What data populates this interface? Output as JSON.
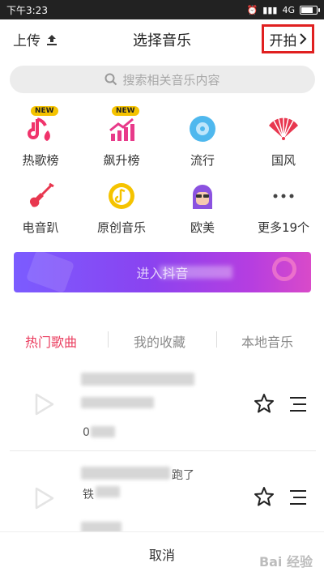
{
  "status_bar": {
    "time": "下午3:23",
    "network": "4G"
  },
  "nav": {
    "upload_label": "上传",
    "title": "选择音乐",
    "start_label": "开拍"
  },
  "search": {
    "placeholder": "搜索相关音乐内容"
  },
  "categories": [
    {
      "label": "热歌榜",
      "icon": "hot-songs-icon",
      "badge": "NEW"
    },
    {
      "label": "飙升榜",
      "icon": "rising-chart-icon",
      "badge": "NEW"
    },
    {
      "label": "流行",
      "icon": "pop-disc-icon"
    },
    {
      "label": "国风",
      "icon": "chinese-fan-icon"
    },
    {
      "label": "电音趴",
      "icon": "electric-guitar-icon"
    },
    {
      "label": "原创音乐",
      "icon": "original-music-icon"
    },
    {
      "label": "欧美",
      "icon": "western-singer-icon"
    },
    {
      "label": "更多19个",
      "icon": "more-dots-icon"
    }
  ],
  "banner": {
    "text": "进入抖音"
  },
  "tabs": [
    {
      "label": "热门歌曲",
      "active": true
    },
    {
      "label": "我的收藏",
      "active": false
    },
    {
      "label": "本地音乐",
      "active": false
    }
  ],
  "songs": [
    {
      "title": "",
      "artist": "",
      "duration": "0"
    },
    {
      "title": "跑了",
      "artist": "铁",
      "duration": ""
    }
  ],
  "footer": {
    "cancel_label": "取消"
  },
  "watermark": "Bai 经验",
  "colors": {
    "accent": "#ea3b5d",
    "highlight_box": "#e02020",
    "search_bg": "#ececec"
  }
}
